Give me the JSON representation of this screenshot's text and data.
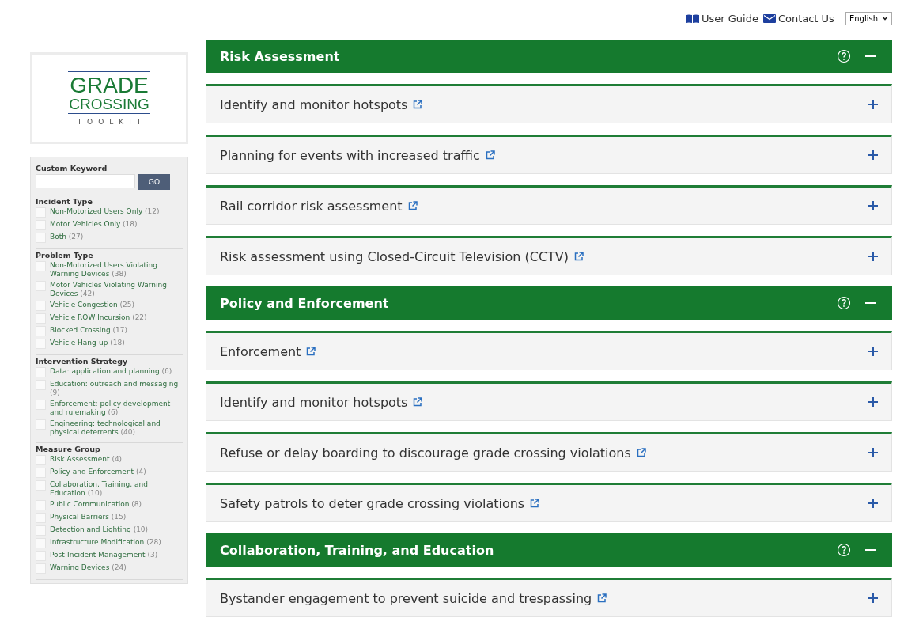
{
  "top_links": [
    {
      "kind": "guide",
      "label": "User Guide"
    },
    {
      "kind": "contact",
      "label": "Contact Us"
    }
  ],
  "language_select": {
    "value": "English"
  },
  "logo": {
    "line_1": "GRADE",
    "line_2": "CROSSING",
    "line_3": "TOOLKIT"
  },
  "keyword": {
    "label": "Custom Keyword",
    "button": "GO"
  },
  "filter_groups": [
    {
      "title": "Incident Type",
      "options": [
        {
          "label": "Non-Motorized Users Only",
          "count": "(12)",
          "checked": false
        },
        {
          "label": "Motor Vehicles Only",
          "count": "(18)",
          "checked": false
        },
        {
          "label": "Both",
          "count": "(27)",
          "checked": false
        }
      ]
    },
    {
      "title": "Problem Type",
      "options": [
        {
          "label": "Non-Motorized Users Violating Warning Devices",
          "count": "(38)",
          "checked": false
        },
        {
          "label": "Motor Vehicles Violating Warning Devices",
          "count": "(42)",
          "checked": false
        },
        {
          "label": "Vehicle Congestion",
          "count": "(25)",
          "checked": false
        },
        {
          "label": "Vehicle ROW Incursion",
          "count": "(22)",
          "checked": false
        },
        {
          "label": "Blocked Crossing",
          "count": "(17)",
          "checked": false
        },
        {
          "label": "Vehicle Hang-up",
          "count": "(18)",
          "checked": false
        }
      ]
    },
    {
      "title": "Intervention Strategy",
      "options": [
        {
          "label": "Data: application and planning",
          "count": "(6)",
          "checked": false
        },
        {
          "label": "Education: outreach and messaging",
          "count": "(9)",
          "checked": false
        },
        {
          "label": "Enforcement: policy development and rulemaking",
          "count": "(6)",
          "checked": false
        },
        {
          "label": "Engineering: technological and physical deterrents",
          "count": "(40)",
          "checked": false
        }
      ]
    },
    {
      "title": "Measure Group",
      "options": [
        {
          "label": "Risk Assessment",
          "count": "(4)",
          "checked": false
        },
        {
          "label": "Policy and Enforcement",
          "count": "(4)",
          "checked": false
        },
        {
          "label": "Collaboration, Training, and Education",
          "count": "(10)",
          "checked": false
        },
        {
          "label": "Public Communication",
          "count": "(8)",
          "checked": false
        },
        {
          "label": "Physical Barriers",
          "count": "(15)",
          "checked": false
        },
        {
          "label": "Detection and Lighting",
          "count": "(10)",
          "checked": false
        },
        {
          "label": "Infrastructure Modification",
          "count": "(28)",
          "checked": false
        },
        {
          "label": "Post-Incident Management",
          "count": "(3)",
          "checked": false
        },
        {
          "label": "Warning Devices",
          "count": "(24)",
          "checked": false
        }
      ]
    }
  ],
  "measure_groups": [
    {
      "title": "Risk Assessment",
      "expanded": true,
      "items": [
        {
          "title": "Identify and monitor hotspots",
          "expanded": false
        },
        {
          "title": "Planning for events with increased traffic",
          "expanded": false
        },
        {
          "title": "Rail corridor risk assessment",
          "expanded": false
        },
        {
          "title": "Risk assessment using Closed-Circuit Television (CCTV)",
          "expanded": false
        }
      ]
    },
    {
      "title": "Policy and Enforcement",
      "expanded": true,
      "items": [
        {
          "title": "Enforcement",
          "expanded": false
        },
        {
          "title": "Identify and monitor hotspots",
          "expanded": false
        },
        {
          "title": "Refuse or delay boarding to discourage grade crossing violations",
          "expanded": false
        },
        {
          "title": "Safety patrols to deter grade crossing violations",
          "expanded": false
        }
      ]
    },
    {
      "title": "Collaboration, Training, and Education",
      "expanded": true,
      "items": [
        {
          "title": "Bystander engagement to prevent suicide and trespassing",
          "expanded": false
        }
      ]
    }
  ]
}
